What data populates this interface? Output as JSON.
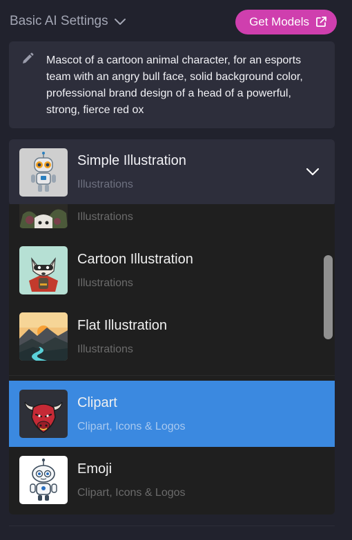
{
  "header": {
    "settings_label": "Basic AI Settings",
    "get_models_label": "Get Models"
  },
  "prompt": {
    "text": "Mascot of a cartoon animal character, for an esports team with an angry bull face, solid background color, professional brand design of a head of a powerful, strong, fierce red ox"
  },
  "style_select": {
    "selected_title": "Simple Illustration",
    "selected_category": "Illustrations",
    "thumbnail_icon": "robot-thumbnail",
    "expanded": true
  },
  "dropdown": {
    "partial_option": {
      "category": "Illustrations",
      "thumbnail_icon": "floral-character-thumbnail"
    },
    "options": [
      {
        "title": "Cartoon Illustration",
        "category": "Illustrations",
        "thumbnail_icon": "raccoon-hero-thumbnail",
        "selected": false
      },
      {
        "title": "Flat Illustration",
        "category": "Illustrations",
        "thumbnail_icon": "landscape-thumbnail",
        "selected": false
      },
      {
        "title": "Clipart",
        "category": "Clipart, Icons & Logos",
        "thumbnail_icon": "bull-head-thumbnail",
        "selected": true
      },
      {
        "title": "Emoji",
        "category": "Clipart, Icons & Logos",
        "thumbnail_icon": "robot-emoji-thumbnail",
        "selected": false
      }
    ]
  },
  "colors": {
    "background": "#21222d",
    "panel": "#2d2e3b",
    "accent_button": "#cf3fae",
    "selected_option": "#3b89e0",
    "dropdown_background": "#1f1f1f"
  }
}
